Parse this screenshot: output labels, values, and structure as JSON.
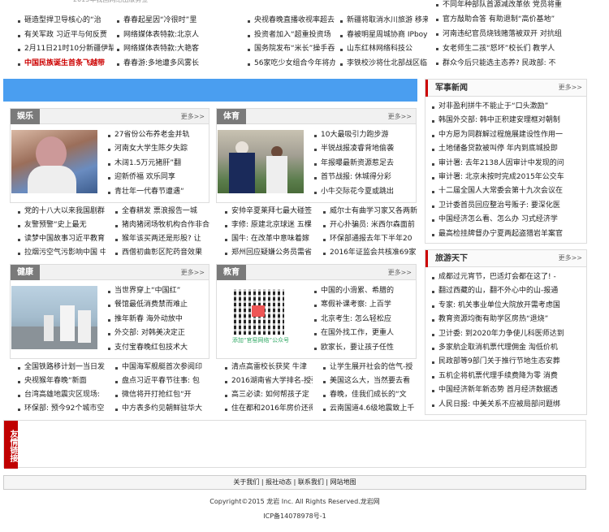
{
  "top_news": {
    "col1": [
      "砸造型捍卫导核心的“治",
      "有关军政 习近平与何反贾",
      "2月11日21时10分新疆伊犁",
      "中国民族诞生首条飞越带"
    ],
    "col2": [
      "春春起星因“冷很时”里",
      "网络媒体表特款:北京人",
      "网络媒体表特款:大艳客",
      "春春游:多地遭多风雾长"
    ],
    "col3": [
      "央视春晚直播收视率超去",
      "投资者加入“超重投资场",
      "国务院发布“米长”操手吞",
      "56家吃少女组合今年将办"
    ],
    "col4": [
      "新疆将取消水川旅游 移来",
      "春被明星周城协商 IPboys",
      "山东红林网络科技公",
      "李铁校沙将仕北部战区临"
    ]
  },
  "right_top": [
    "不同年种部队首源减改革依 党员将重",
    "官方敲助合答 有助退制“高价基地”",
    "河南违纪官员烧钱赌落被双开 对抗组",
    "女老师生二孩“怒坏”校长们 教学人",
    "群众今后只能选主态养? 民政部: 不"
  ],
  "military": {
    "title": "军事新闻",
    "more": "更多>>",
    "items": [
      "对非盈利拼牛不能止于“口头激励”",
      "韩国外交部: 韩中正积建安理框对朝制",
      "中方愿为同群解过程施展建设性作用一",
      "土地储备贷款被叫停 年内到底城投即",
      "审计署: 去年2138人因审计中发现的问",
      "审计署: 北京未按时完成2015年公交车",
      "十二届全国人大常委会第十九次会议在",
      "卫计委首员回应整治号贩子: 要深化医",
      "中国经济怎么看、怎么办 习式经济学",
      "最高检挂牌督办宁夏两起盗猎岩羊案官"
    ]
  },
  "travel": {
    "title": "旅游天下",
    "more": "更多>>",
    "items": [
      "成都过元宵节，巴适灯会都在这了! -",
      "翻过西藏的山，翻不外心中的山-报通",
      "专家: 机关事业单位大院放开需考虑国",
      "教育资源均衡有助学区房热“退烧”",
      "卫计委: 到2020年力争使儿科医师达到",
      "多家航企取消机票代理佣金 淘低价机",
      "民政部等9部门关于推行节地生态安葬",
      "五机企将机票代理手续费降为零 消费",
      "中国经济新年新态势 首月经济数据透",
      "人民日报: 中美关系不应被局部问题绑"
    ]
  },
  "ent": {
    "tag": "娱乐",
    "more": "更多>>",
    "items": [
      "27省份公布养老金并轨",
      "河南女大学生陈夕失踪",
      "木阔1.5万元猪肝”翻",
      "迎新侨福 欢乐同享",
      "青壮年一代春节遭遇“"
    ]
  },
  "sport": {
    "tag": "体育",
    "more": "更多>>",
    "items": [
      "10大最吸引力跑步游",
      "半锐战报凌睿背地偷袭",
      "年报曝最新资源惹足去",
      "首节战报: 休城得分彩",
      "小牛交际花今夏或跳出"
    ]
  },
  "health": {
    "tag": "健康",
    "more": "更多>>",
    "items": [
      "当世界穿上“中国红”",
      "餐馆最低消费禁而难止",
      "推年新春 海外动放中",
      "外交部: 对韩美决定正",
      "支付宝春晚红包技术大"
    ]
  },
  "edu": {
    "tag": "教育",
    "more": "更多>>",
    "items": [
      "中国的小滑累、希腊的",
      "寒假补课考察: 上百学",
      "北京考生: 怎么轻松应",
      "在国外找工作，更重人",
      "欧家长，要让孩子任性"
    ],
    "qr_caption": "添加“官窑网络”公众号"
  },
  "ent_list": {
    "a": [
      "党的十八大以来我国剧群",
      "友警预警“史上最无",
      "读梦中国故事习近平教育",
      "拉烟污空气污影响中国 中"
    ],
    "b": [
      "全春耕发 票浪报告一城",
      "猪肉猪闭场牧机构合作非合",
      "猴年该买两还是形股? 让",
      "西僧初曲彰区陀药音效果"
    ]
  },
  "sport_list": {
    "a": [
      "安帅辛夏莱拜七最大碰签",
      "李修: 原建北京球迷 五棵",
      "国牛: 在改革中意味着嫁",
      "郑州回应疑嫌公务员需省"
    ],
    "b": [
      "威尔士有曲学习家又各两新",
      "开心扑骗员: 米西尔森面前",
      "环保部通报去年下半年20",
      "2016年证监会共核准69家"
    ]
  },
  "health_list": {
    "a": [
      "全国铁路移计划一当日发",
      "央视猴年春晚“新面",
      "台湾高雄地震灾区现场:",
      "环保部: 预今92个城市空"
    ],
    "b": [
      "中国海军舰艇首次参阅印",
      "盘点习近平春节往事: 包",
      "微信将开打抢红包“开",
      "中方表多约见朝鲜驻华大"
    ]
  },
  "edu_list": {
    "a": [
      "清点高雷校长获奖 牛津",
      "2016湖南省大学排名-授强",
      "高三必读: 如何帮孩子定",
      "住在都和2016年房价还得"
    ],
    "b": [
      "让学生展开社会的信气-授",
      "美国这么大，当然要去看",
      "春晚，佳我们成长的“文",
      "云南国道4.6级地震致上千"
    ]
  },
  "friends": {
    "label": "友情链接"
  },
  "footer": {
    "links": [
      "关于我们",
      "报社动态",
      "联系我们",
      "网站地图"
    ],
    "copyright": "Copyright©2015 龙岩 Inc. All Rights Reserved.龙岩网",
    "icp": "ICP备14078978号-1"
  },
  "colors": {
    "blue_bar": "#4a9ef0",
    "accent_red": "#c00000",
    "tag_gray": "#7a7a7a"
  }
}
